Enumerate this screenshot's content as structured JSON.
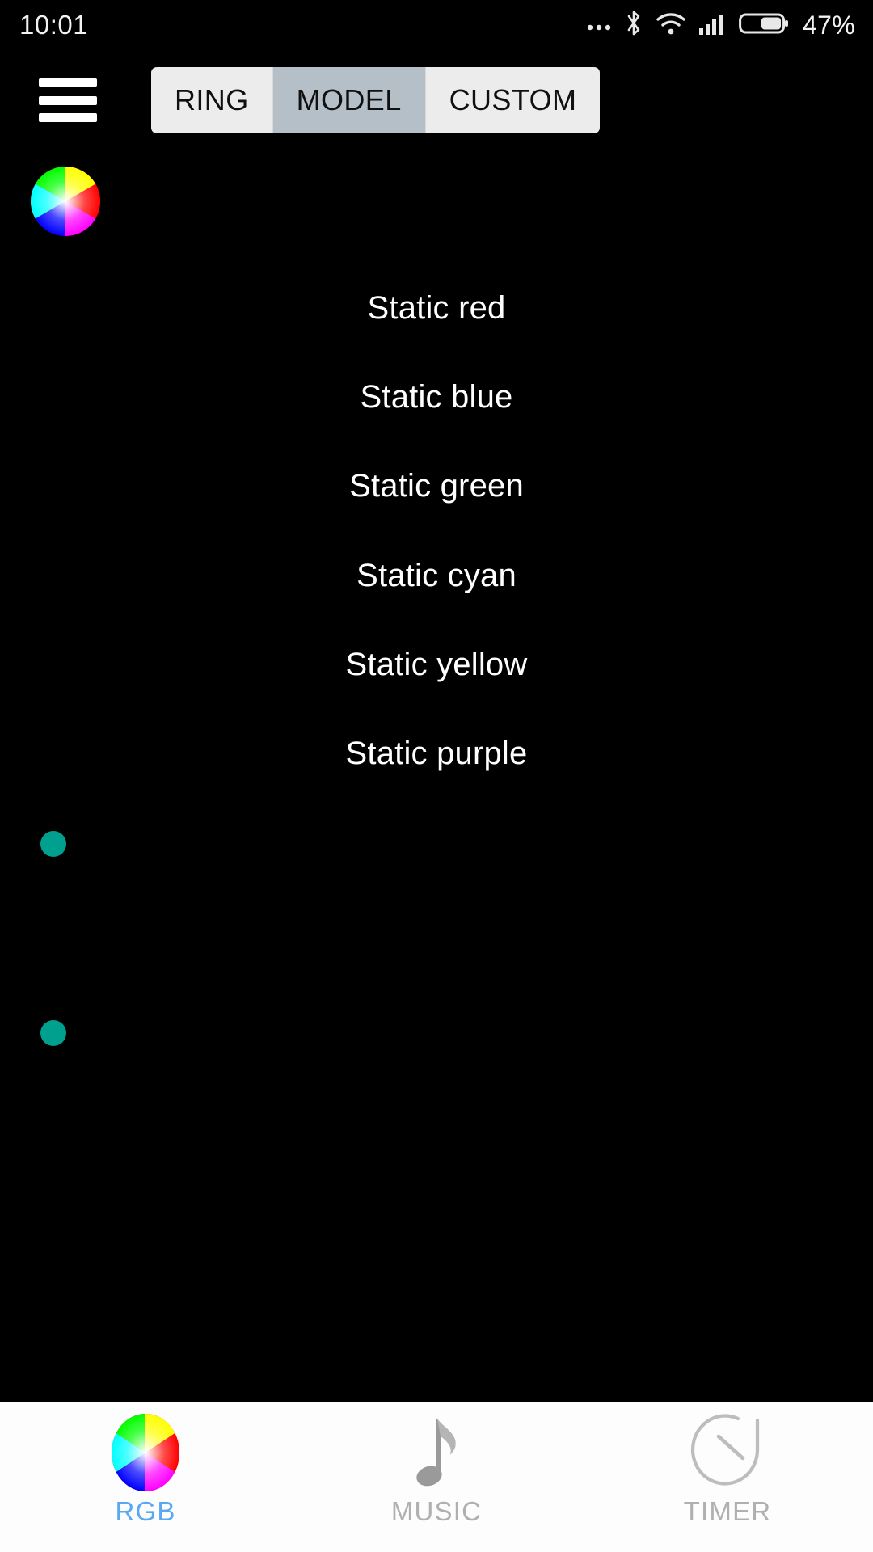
{
  "status_bar": {
    "time": "10:01",
    "battery_percent": "47%",
    "icons": [
      "more-horizontal-icon",
      "bluetooth-icon",
      "wifi-icon",
      "cellular-signal-icon",
      "battery-icon"
    ]
  },
  "top_bar": {
    "menu_icon": "hamburger-menu-icon",
    "tabs": [
      {
        "label": "RING",
        "selected": false
      },
      {
        "label": "MODEL",
        "selected": true
      },
      {
        "label": "CUSTOM",
        "selected": false
      }
    ]
  },
  "main": {
    "color_wheel_icon": "color-wheel-icon",
    "modes": [
      {
        "label": "Static red"
      },
      {
        "label": "Static blue"
      },
      {
        "label": "Static green"
      },
      {
        "label": "Static cyan"
      },
      {
        "label": "Static yellow"
      },
      {
        "label": "Static purple"
      }
    ],
    "slider_thumbs": [
      {
        "name": "brightness-slider-thumb"
      },
      {
        "name": "speed-slider-thumb"
      }
    ]
  },
  "bottom_nav": {
    "items": [
      {
        "label": "RGB",
        "icon": "color-wheel-icon",
        "active": true
      },
      {
        "label": "MUSIC",
        "icon": "music-note-icon",
        "active": false
      },
      {
        "label": "TIMER",
        "icon": "timer-icon",
        "active": false
      }
    ]
  },
  "colors": {
    "background": "#000000",
    "text": "#ffffff",
    "tab_inactive": "#ececec",
    "tab_active": "#b4bfc8",
    "dot_teal": "#00a08e",
    "nav_background": "#fdfdfd",
    "nav_active_text": "#5aa9f0",
    "nav_inactive_text": "#b0b0b0"
  }
}
